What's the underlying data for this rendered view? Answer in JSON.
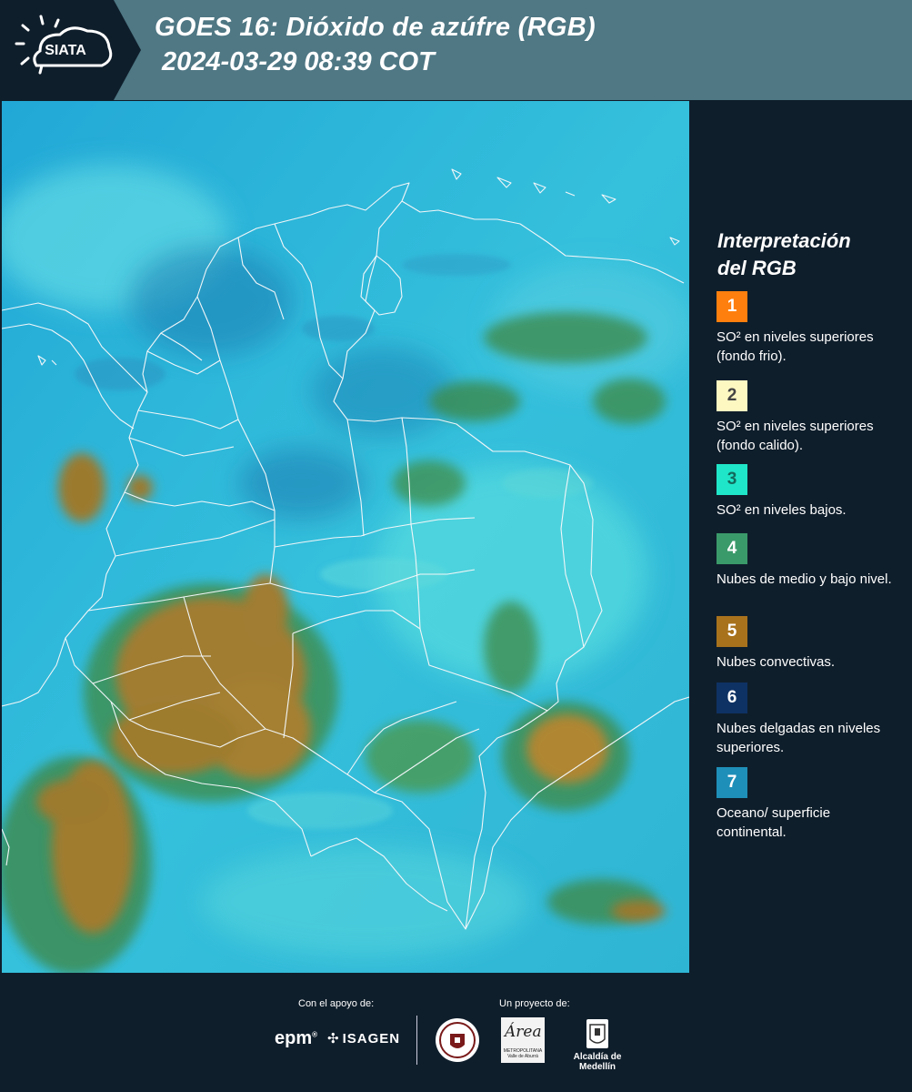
{
  "header": {
    "logo_text": "SIATA",
    "title_line1": "GOES 16: Dióxido de azúfre (RGB)",
    "title_line2": "2024-03-29 08:39 COT",
    "background_color": "#4f7784"
  },
  "map": {
    "product": "GOES 16 SO2 RGB composite",
    "colors": {
      "ocean_surface": "#1aa6d0",
      "low_so2": "#3fd6c8",
      "mid_low_clouds": "#3a8a55",
      "convective": "#9a7a2c"
    }
  },
  "legend": {
    "title_line1": "Interpretación",
    "title_line2": "del RGB",
    "items": [
      {
        "number": "1",
        "color": "#ff7f0e",
        "text": "SO² en niveles superiores (fondo frio)."
      },
      {
        "number": "2",
        "color": "#fdf7c2",
        "text": "SO² en niveles superiores (fondo calido)."
      },
      {
        "number": "3",
        "color": "#1fe6c8",
        "text": "SO² en niveles bajos."
      },
      {
        "number": "4",
        "color": "#3a9a6a",
        "text": "Nubes de medio y bajo nivel."
      },
      {
        "number": "5",
        "color": "#a8721c",
        "text": "Nubes convectivas."
      },
      {
        "number": "6",
        "color": "#0e3264",
        "text": "Nubes delgadas en niveles superiores."
      },
      {
        "number": "7",
        "color": "#1e8fb8",
        "text": "Oceano/ superficie continental."
      }
    ]
  },
  "footer": {
    "support_label": "Con el apoyo de:",
    "project_label": "Un proyecto de:",
    "sponsor_epm": "epm",
    "sponsor_isagen": "ISAGEN",
    "area_logo_word": "Área",
    "area_logo_sub": "METROPOLITANA Valle de Aburrá",
    "alcaldia_text": "Alcaldía de Medellín"
  }
}
